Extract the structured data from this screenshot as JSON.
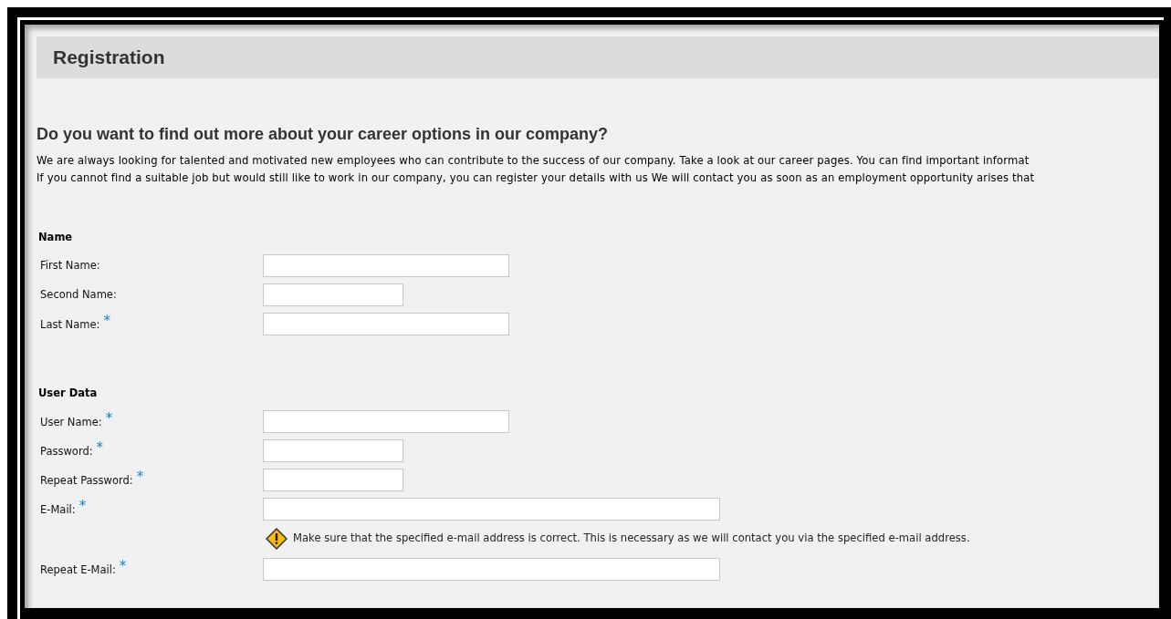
{
  "header": {
    "title": "Registration"
  },
  "intro": {
    "heading": "Do you want to find out more about your career options in our company?",
    "paragraphs": [
      "We are always looking for talented and motivated new employees who can contribute to the success of our company. Take a look at our career pages. You can find important informat",
      "If you cannot find a suitable job but would still like to work in our company, you can register your details with us We will contact you as soon as an employment opportunity arises that"
    ]
  },
  "sections": [
    {
      "title": "Name",
      "rows": [
        {
          "kind": "text",
          "label": "First Name:",
          "required": false
        },
        {
          "kind": "short-text",
          "label": "Second Name:",
          "required": false
        },
        {
          "kind": "text",
          "label": "Last Name:",
          "required": true
        }
      ]
    },
    {
      "title": "User Data",
      "rows": [
        {
          "kind": "text",
          "label": "User Name:",
          "required": true
        },
        {
          "kind": "password",
          "label": "Password:",
          "required": true
        },
        {
          "kind": "password",
          "label": "Repeat Password:",
          "required": true
        },
        {
          "kind": "email",
          "label": "E-Mail:",
          "required": true
        },
        {
          "kind": "notice",
          "text": "Make sure that the specified e-mail address is correct. This is necessary as we will contact you via the specified e-mail address."
        },
        {
          "kind": "email",
          "label": "Repeat E-Mail:",
          "required": true
        }
      ]
    }
  ],
  "required_mark": "*"
}
